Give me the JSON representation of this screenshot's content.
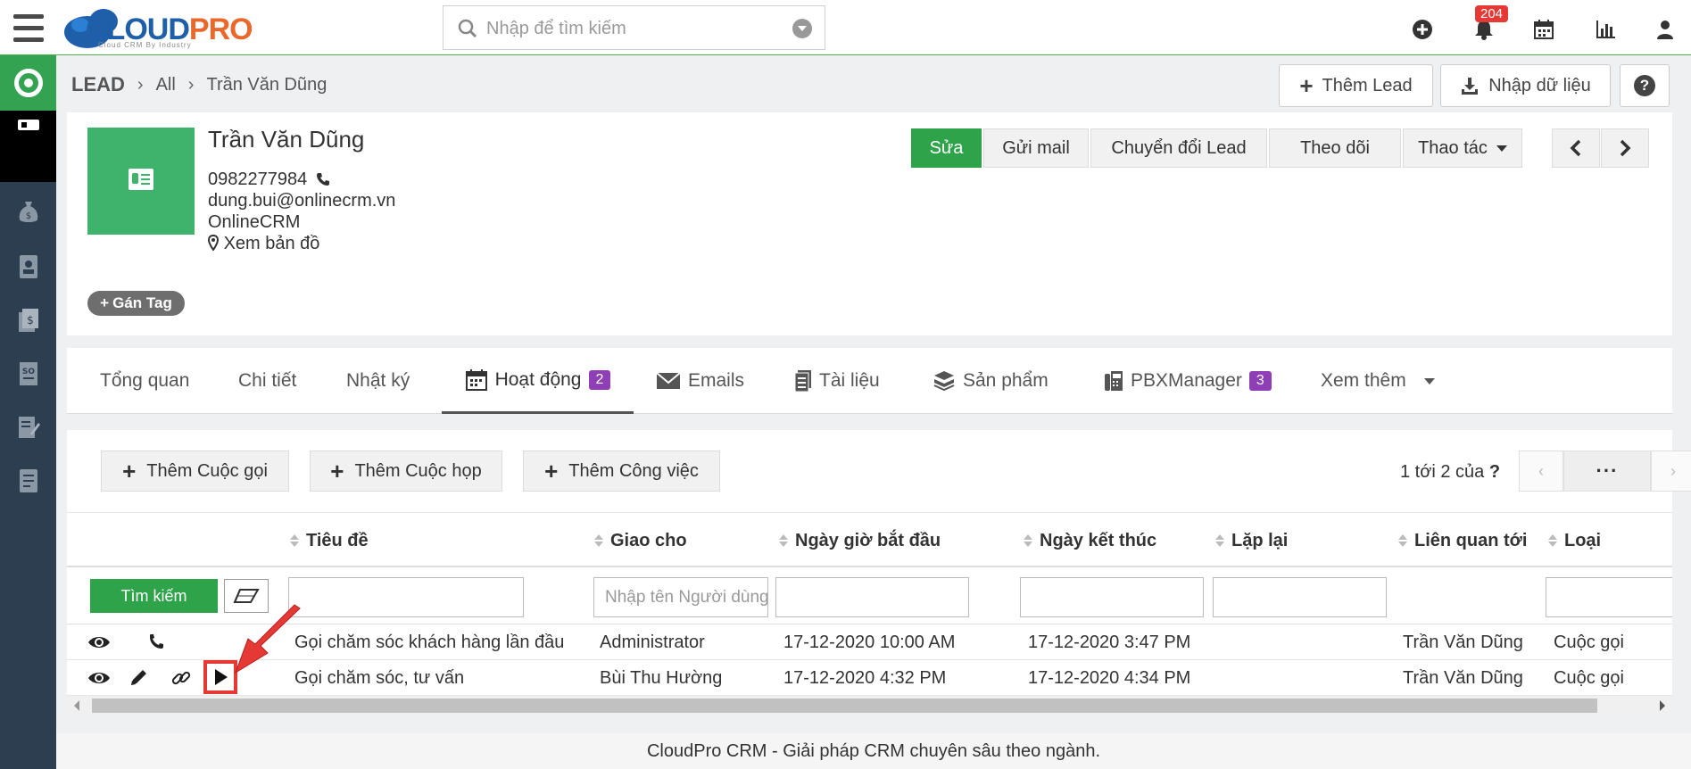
{
  "app": {
    "logo_text_a": "CLOUD",
    "logo_text_b": "PRO",
    "logo_tagline": "Cloud CRM By Industry",
    "search_placeholder": "Nhập để tìm kiếm",
    "notification_count": "204"
  },
  "breadcrumb": {
    "module": "LEAD",
    "filter": "All",
    "record": "Trần Văn Dũng"
  },
  "toolbar": {
    "add_lead": "Thêm Lead",
    "import": "Nhập dữ liệu",
    "help": "?"
  },
  "record": {
    "name": "Trần Văn Dũng",
    "phone": "0982277984",
    "email": "dung.bui@onlinecrm.vn",
    "company": "OnlineCRM",
    "map_link": "Xem bản đồ",
    "tag_button": "Gán Tag"
  },
  "actions": {
    "edit": "Sửa",
    "send_mail": "Gửi mail",
    "convert": "Chuyển đổi Lead",
    "follow": "Theo dõi",
    "more": "Thao tác"
  },
  "tabs": [
    {
      "label": "Tổng quan"
    },
    {
      "label": "Chi tiết"
    },
    {
      "label": "Nhật ký"
    },
    {
      "label": "Hoạt động",
      "count": "2"
    },
    {
      "label": "Emails"
    },
    {
      "label": "Tài liệu"
    },
    {
      "label": "Sản phẩm"
    },
    {
      "label": "PBXManager",
      "count": "3"
    },
    {
      "label": "Xem thêm"
    }
  ],
  "activities": {
    "add_call": "Thêm Cuộc gọi",
    "add_meeting": "Thêm Cuộc họp",
    "add_task": "Thêm Công việc",
    "pager_text": "1 tới 2  của",
    "pager_total": "?",
    "pager_more": "···",
    "columns": [
      "Tiêu đề",
      "Giao cho",
      "Ngày giờ bắt đầu",
      "Ngày kết thúc",
      "Lặp lại",
      "Liên quan tới",
      "Loại"
    ],
    "search_button": "Tìm kiếm",
    "assignee_placeholder": "Nhập tên Người dùng",
    "rows": [
      {
        "title": "Gọi chăm sóc khách hàng lần đầu",
        "assigned": "Administrator",
        "start": "17-12-2020 10:00 AM",
        "end": "17-12-2020 3:47 PM",
        "repeat": "",
        "related": "Trần Văn Dũng",
        "type": "Cuộc gọi"
      },
      {
        "title": "Gọi chăm sóc, tư vấn",
        "assigned": "Bùi Thu Hường",
        "start": "17-12-2020 4:32 PM",
        "end": "17-12-2020 4:34 PM",
        "repeat": "",
        "related": "Trần Văn Dũng",
        "type": "Cuộc gọi"
      }
    ]
  },
  "footer": "CloudPro CRM - Giải pháp CRM chuyên sâu theo ngành.",
  "colors": {
    "accent_green": "#2ea34a",
    "sidebar": "#2d3e50",
    "badge_red": "#e53935",
    "count_purple": "#8e3fb6",
    "highlight": "#e53935"
  }
}
